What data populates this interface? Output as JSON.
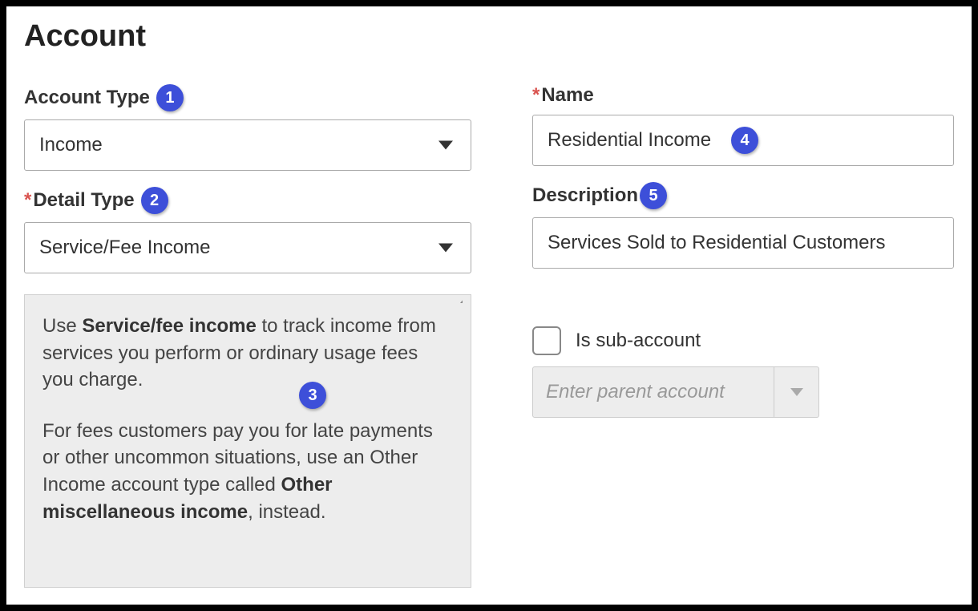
{
  "page_title": "Account",
  "labels": {
    "account_type": "Account Type",
    "detail_type": "Detail Type",
    "name": "Name",
    "description": "Description",
    "is_sub_account": "Is sub-account"
  },
  "values": {
    "account_type": "Income",
    "detail_type": "Service/Fee Income",
    "name": "Residential Income",
    "description": "Services Sold to Residential Customers",
    "parent_placeholder": "Enter parent account"
  },
  "help": {
    "p1_pre": "Use ",
    "p1_strong": "Service/fee income",
    "p1_post": " to track income from services you perform or ordinary usage fees you charge.",
    "p2_pre": "For fees customers pay you for late payments or other uncommon situations, use an Other Income account type called ",
    "p2_strong": "Other miscellaneous income",
    "p2_post": ", instead."
  },
  "annotations": {
    "b1": "1",
    "b2": "2",
    "b3": "3",
    "b4": "4",
    "b5": "5"
  }
}
